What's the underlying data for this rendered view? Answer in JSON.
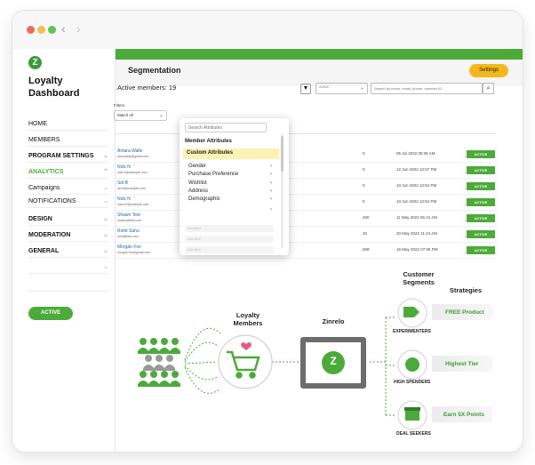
{
  "nav": {
    "back": "‹",
    "forward": "›"
  },
  "sidebar": {
    "logo_letter": "Z",
    "brand": "Loyalty Dashboard",
    "items": [
      {
        "label": "HOME",
        "chevron": ""
      },
      {
        "label": "MEMBERS",
        "chevron": ""
      },
      {
        "label": "PROGRAM SETTINGS",
        "chevron": "⌄"
      },
      {
        "label": "ANALYTICS",
        "chevron": "⌃"
      },
      {
        "label": "Campaigns",
        "chevron": "⌄"
      },
      {
        "label": "NOTIFICATIONS",
        "chevron": "⌄"
      },
      {
        "label": "DESIGN",
        "chevron": "⌄"
      },
      {
        "label": "MODERATION",
        "chevron": "⌄"
      },
      {
        "label": "GENERAL",
        "chevron": "⌄"
      }
    ],
    "extra_chevron": "⌄",
    "status_pill": "ACTIVE"
  },
  "header": {
    "title": "Segmentation",
    "settings_label": "Settings"
  },
  "toolbar": {
    "active_members": "Active members: 19",
    "filter_icon": "▼",
    "select_value": "Active",
    "select_chevron": "⌄",
    "search_placeholder": "Search by name, email, phone, member ID",
    "search_icon": "⌕"
  },
  "filters": {
    "label": "Filters",
    "match_value": "Match All",
    "match_chevron": "⌄"
  },
  "members": [
    {
      "name": "Amara Walls",
      "email": "ama.walls@gmail.com",
      "points": "0",
      "date": "05 Jul 2022 08:35 AM",
      "status": "ACTIVE"
    },
    {
      "name": "Nick N",
      "email": "nick.n@example.com",
      "points": "0",
      "date": "12 Jun 2022 12:07 PM",
      "status": "ACTIVE"
    },
    {
      "name": "Sid B",
      "email": "sid.b@example.com",
      "points": "0",
      "date": "10 Jun 2022 12:54 PM",
      "status": "ACTIVE"
    },
    {
      "name": "Nick N",
      "email": "nick.n2@example.com",
      "points": "0",
      "date": "10 Jun 2022 12:54 PM",
      "status": "ACTIVE"
    },
    {
      "name": "Shawn Test",
      "email": "shawn@test.com",
      "points": "400",
      "date": "11 May 2022 06:41 AM",
      "status": "ACTIVE"
    },
    {
      "name": "Rohit Sahu",
      "email": "rohit@test.com",
      "points": "20",
      "date": "20 May 2022 11:24 AM",
      "status": "ACTIVE"
    },
    {
      "name": "Morgan Fox",
      "email": "morgan.fox@gmail.com",
      "points": "509",
      "date": "16 May 2022 07:06 PM",
      "status": "ACTIVE"
    }
  ],
  "dropdown": {
    "search_placeholder": "Search Attributes",
    "member_heading": "Member Attributes",
    "custom_heading": "Custom Attributes",
    "items": [
      {
        "label": "Gender",
        "chevron": "›"
      },
      {
        "label": "Purchase Preference",
        "chevron": "›"
      },
      {
        "label": "Wishlist",
        "chevron": "›"
      },
      {
        "label": "Address",
        "chevron": "›"
      },
      {
        "label": "Demographic",
        "chevron": "›"
      }
    ],
    "extra_chevron": "›",
    "faint_items": [
      "Add More",
      "Add More",
      "Add More"
    ]
  },
  "diagram": {
    "loyalty_members": "Loyalty\nMembers",
    "zinrelo": "Zinrelo",
    "logo_letter": "Z",
    "customer_segments": "Customer\nSegments",
    "strategies": "Strategies",
    "segments": [
      {
        "label": "EXPERIMENTERS",
        "strategy": "FREE Product",
        "icon": "🏷"
      },
      {
        "label": "HIGH SPENDERS",
        "strategy": "Highest Tier",
        "icon": "$"
      },
      {
        "label": "DEAL SEEKERS",
        "strategy": "Earn 5X Points",
        "icon": "🎁"
      }
    ],
    "colors": {
      "green": "#4caa3b",
      "dark_green": "#2f7d2a",
      "grey": "#9a9a9a",
      "pink": "#e45a82"
    }
  }
}
